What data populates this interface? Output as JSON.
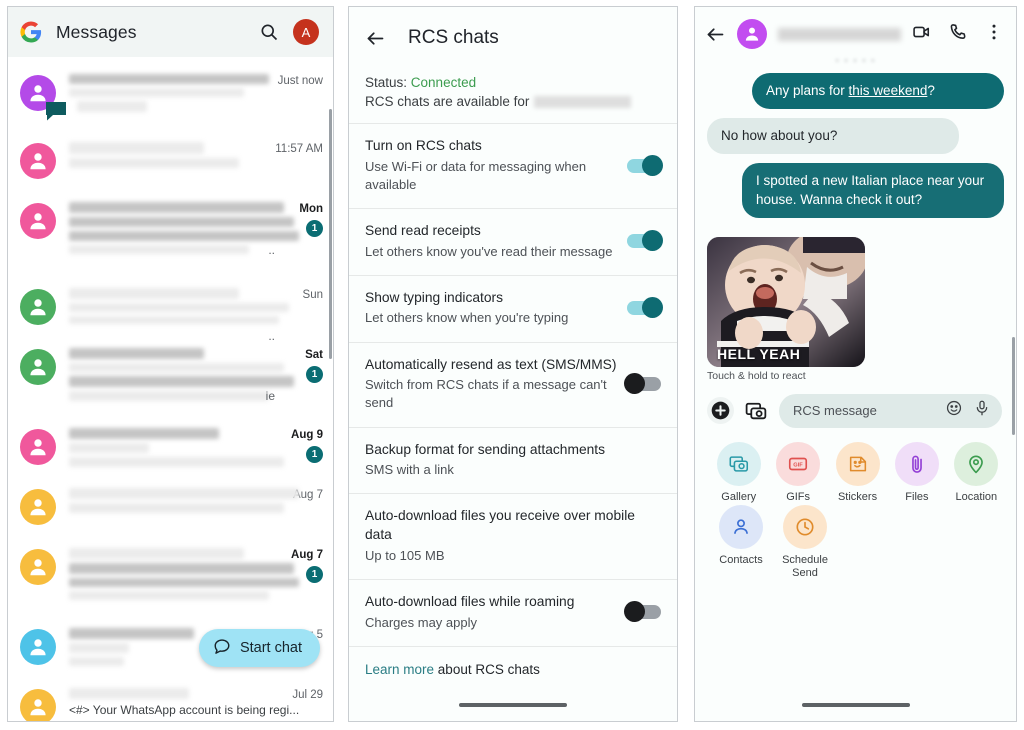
{
  "left_panel": {
    "appbar": {
      "logo": "google-g-logo",
      "title": "Messages",
      "search_icon": "search-icon",
      "account_initial": "A",
      "account_color": "#c5321d"
    },
    "conversations": [
      {
        "avatar_color": "#b44ae8",
        "has_rcs_badge": true,
        "time": "Just now",
        "unread": null,
        "redacted": true
      },
      {
        "avatar_color": "#f0589c",
        "has_rcs_badge": false,
        "time": "11:57 AM",
        "unread": null,
        "redacted": true
      },
      {
        "avatar_color": "#f0589c",
        "has_rcs_badge": false,
        "time": "Mon",
        "unread": "1",
        "redacted": true,
        "tail": ".."
      },
      {
        "avatar_color": "#4cae60",
        "has_rcs_badge": false,
        "time": "Sun",
        "unread": null,
        "redacted": true,
        "tail": ".."
      },
      {
        "avatar_color": "#4cae60",
        "has_rcs_badge": false,
        "time": "Sat",
        "unread": "1",
        "redacted": true,
        "tail": "ie"
      },
      {
        "avatar_color": "#f0589c",
        "has_rcs_badge": false,
        "time": "Aug 9",
        "unread": "1",
        "redacted": true
      },
      {
        "avatar_color": "#f7bd3e",
        "has_rcs_badge": false,
        "time": "Aug 7",
        "unread": null,
        "redacted": true
      },
      {
        "avatar_color": "#f7bd3e",
        "has_rcs_badge": false,
        "time": "Aug 7",
        "unread": "1",
        "redacted": true
      },
      {
        "avatar_color": "#4ec3e8",
        "has_rcs_badge": false,
        "time": "Aug 5",
        "unread": null,
        "redacted": true
      },
      {
        "avatar_color": "#f7bd3e",
        "has_rcs_badge": false,
        "time": "Jul 29",
        "unread": null,
        "redacted": true,
        "snippet": "<#> Your WhatsApp account is being regi..."
      }
    ],
    "fab": {
      "label": "Start chat",
      "icon": "chat-bubble-icon",
      "color": "#9fe3f5"
    }
  },
  "mid_panel": {
    "appbar": {
      "back_icon": "back-arrow-icon",
      "title": "RCS chats"
    },
    "status": {
      "label": "Status:",
      "value": "Connected",
      "value_color": "#3c9c4f",
      "available_text": "RCS chats are available for",
      "available_value_redacted": true
    },
    "settings": [
      {
        "title": "Turn on RCS chats",
        "subtitle": "Use Wi-Fi or data for messaging when available",
        "control": "toggle",
        "state": "on"
      },
      {
        "title": "Send read receipts",
        "subtitle": "Let others know you've read their message",
        "control": "toggle",
        "state": "on"
      },
      {
        "title": "Show typing indicators",
        "subtitle": "Let others know when you're typing",
        "control": "toggle",
        "state": "on"
      },
      {
        "title": "Automatically resend as text (SMS/MMS)",
        "subtitle": "Switch from RCS chats if a message can't send",
        "control": "toggle",
        "state": "off"
      },
      {
        "title": "Backup format for sending attachments",
        "subtitle": "SMS with a link",
        "control": "none",
        "state": ""
      },
      {
        "title": "Auto-download files you receive over mobile data",
        "subtitle": "Up to 105 MB",
        "control": "none",
        "state": ""
      },
      {
        "title": "Auto-download files while roaming",
        "subtitle": "Charges may apply",
        "control": "toggle",
        "state": "off"
      }
    ],
    "learn_more": {
      "link_text": "Learn more",
      "rest_text": " about RCS chats"
    }
  },
  "right_panel": {
    "appbar": {
      "back_icon": "back-arrow-icon",
      "contact_avatar_color": "#c24df0",
      "contact_name_redacted": true,
      "video_call_icon": "video-camera-icon",
      "voice_call_icon": "phone-icon",
      "overflow_icon": "more-vertical-icon"
    },
    "messages": [
      {
        "direction": "out",
        "text": "Any plans for this weekend?",
        "link_span": "this weekend"
      },
      {
        "direction": "in",
        "text": "No how about you?"
      },
      {
        "direction": "out",
        "text": "I spotted a new Italian place near your house. Wanna check it out?"
      },
      {
        "direction": "in",
        "type": "gif",
        "caption": "HELL YEAH",
        "hint": "Touch & hold to react"
      }
    ],
    "composer": {
      "plus_icon": "plus-icon",
      "gallery_icon": "gallery-icon",
      "placeholder": "RCS message",
      "emoji_icon": "emoji-icon",
      "mic_icon": "microphone-icon"
    },
    "attachments": [
      {
        "label": "Gallery",
        "icon": "gallery-icon",
        "bg": "#dbf0f2",
        "fg": "#2a9aa8"
      },
      {
        "label": "GIFs",
        "icon": "gif-icon",
        "bg": "#fadcdc",
        "fg": "#e0514f"
      },
      {
        "label": "Stickers",
        "icon": "sticker-icon",
        "bg": "#fce5cb",
        "fg": "#e08b2c"
      },
      {
        "label": "Files",
        "icon": "paperclip-icon",
        "bg": "#f0def8",
        "fg": "#9340d6"
      },
      {
        "label": "Location",
        "icon": "map-pin-icon",
        "bg": "#ddefdd",
        "fg": "#3c9c4f"
      },
      {
        "label": "Contacts",
        "icon": "person-icon",
        "bg": "#dde6f8",
        "fg": "#3b6fd4"
      },
      {
        "label": "Schedule Send",
        "icon": "clock-icon",
        "bg": "#fce5cb",
        "fg": "#e08b2c"
      }
    ]
  }
}
